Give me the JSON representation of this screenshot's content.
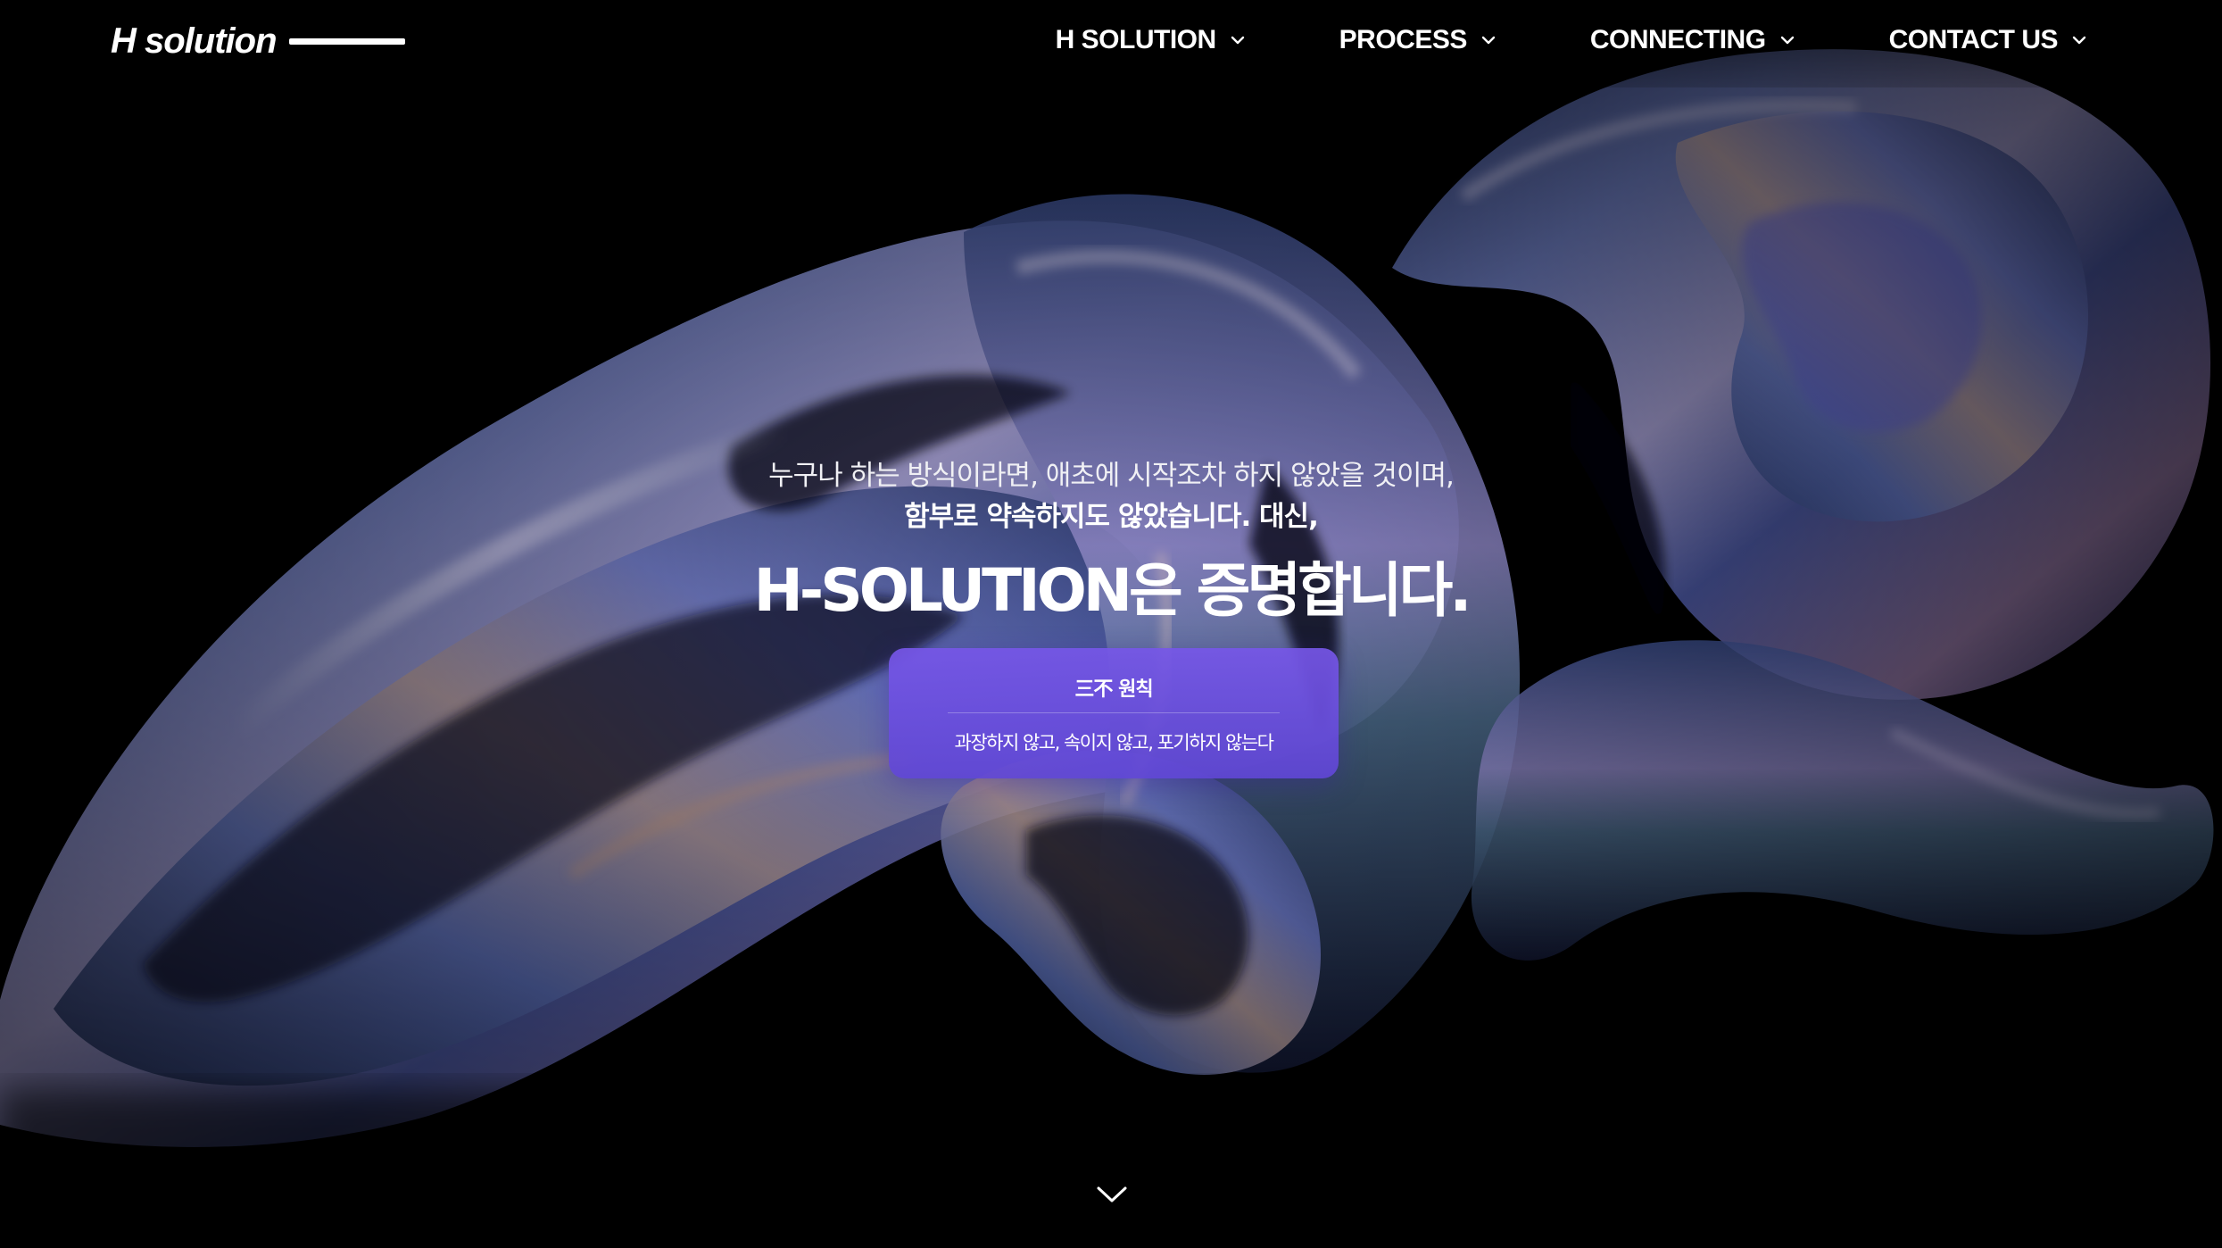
{
  "header": {
    "logo_text": "H solution",
    "nav": [
      {
        "label": "H SOLUTION",
        "icon": "chevron-down-icon"
      },
      {
        "label": "PROCESS",
        "icon": "chevron-down-icon"
      },
      {
        "label": "CONNECTING",
        "icon": "chevron-down-icon"
      },
      {
        "label": "CONTACT US",
        "icon": "chevron-down-icon"
      }
    ]
  },
  "hero": {
    "line1": "누구나 하는 방식이라면, 애초에 시작조차 하지 않았을 것이며,",
    "line2": "함부로 약속하지도 않았습니다. 대신,",
    "title": "H-SOLUTION은 증명합니다.",
    "principle": {
      "title": "三不 원칙",
      "description": "과장하지 않고, 속이지 않고, 포기하지 않는다"
    },
    "scroll_icon": "chevron-down-icon"
  },
  "colors": {
    "background": "#000000",
    "card_accent": "#7656e8",
    "text": "#ffffff"
  }
}
